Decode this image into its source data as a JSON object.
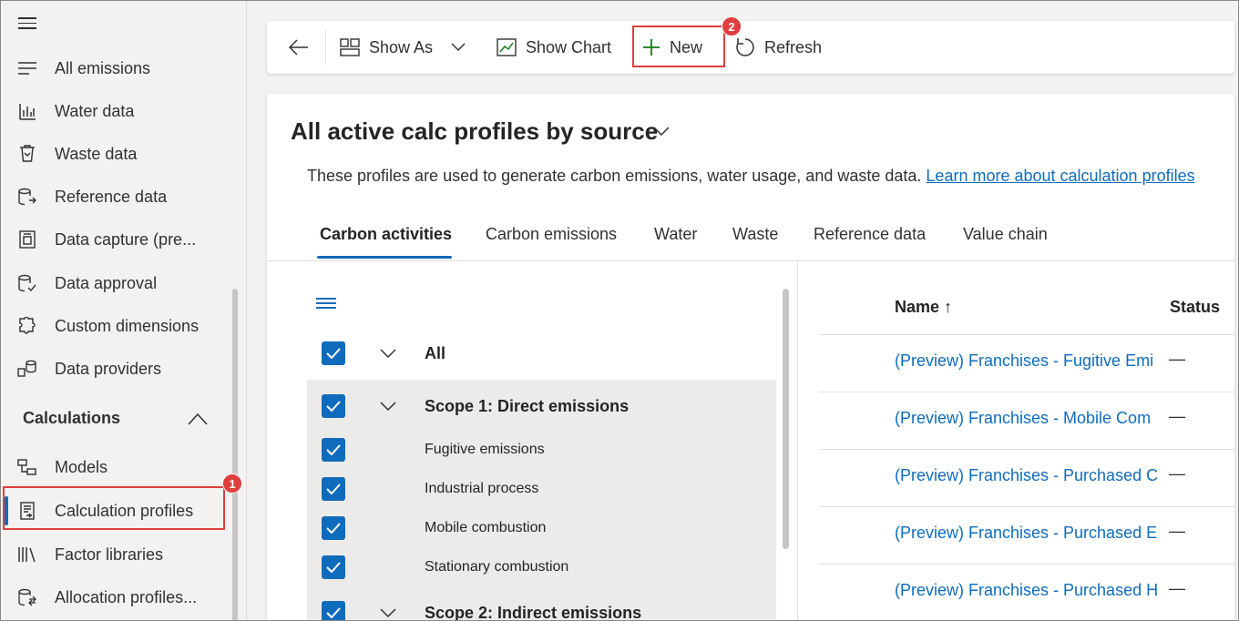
{
  "sidebar": {
    "items": [
      {
        "label": "All emissions",
        "icon": "list-icon"
      },
      {
        "label": "Water data",
        "icon": "water-chart-icon"
      },
      {
        "label": "Waste data",
        "icon": "waste-bin-icon"
      },
      {
        "label": "Reference data",
        "icon": "reference-data-icon"
      },
      {
        "label": "Data capture (pre...",
        "icon": "data-capture-icon"
      },
      {
        "label": "Data approval",
        "icon": "data-approval-icon"
      },
      {
        "label": "Custom dimensions",
        "icon": "puzzle-icon"
      },
      {
        "label": "Data providers",
        "icon": "data-providers-icon"
      }
    ],
    "section": {
      "label": "Calculations"
    },
    "calc_items": [
      {
        "label": "Models",
        "icon": "models-icon"
      },
      {
        "label": "Calculation profiles",
        "icon": "calculation-profile-icon"
      },
      {
        "label": "Factor libraries",
        "icon": "library-icon"
      },
      {
        "label": "Allocation profiles...",
        "icon": "allocation-icon"
      }
    ]
  },
  "annotations": {
    "badge1": "1",
    "badge2": "2",
    "color": "#e03e3e"
  },
  "commandbar": {
    "show_as": "Show As",
    "show_chart": "Show Chart",
    "new": "New",
    "refresh": "Refresh"
  },
  "view": {
    "title": "All active calc profiles by source",
    "description": "These profiles are used to generate carbon emissions, water usage, and waste data.",
    "learn_more": "Learn more about calculation profiles"
  },
  "tabs": [
    "Carbon activities",
    "Carbon emissions",
    "Water",
    "Waste",
    "Reference data",
    "Value chain"
  ],
  "tree": {
    "all": "All",
    "scope1": "Scope 1: Direct emissions",
    "scope1_items": [
      "Fugitive emissions",
      "Industrial process",
      "Mobile combustion",
      "Stationary combustion"
    ],
    "scope2": "Scope 2: Indirect emissions"
  },
  "grid": {
    "columns": {
      "name": "Name ↑",
      "status": "Status"
    },
    "rows": [
      {
        "name": "(Preview) Franchises - Fugitive Emi",
        "status": "—"
      },
      {
        "name": "(Preview) Franchises - Mobile Com",
        "status": "—"
      },
      {
        "name": "(Preview) Franchises - Purchased C",
        "status": "—"
      },
      {
        "name": "(Preview) Franchises - Purchased E",
        "status": "—"
      },
      {
        "name": "(Preview) Franchises - Purchased H",
        "status": "—"
      }
    ]
  },
  "colors": {
    "accent": "#0f6cbd",
    "highlight": "#e03e3e",
    "new_icon": "#107c10"
  }
}
